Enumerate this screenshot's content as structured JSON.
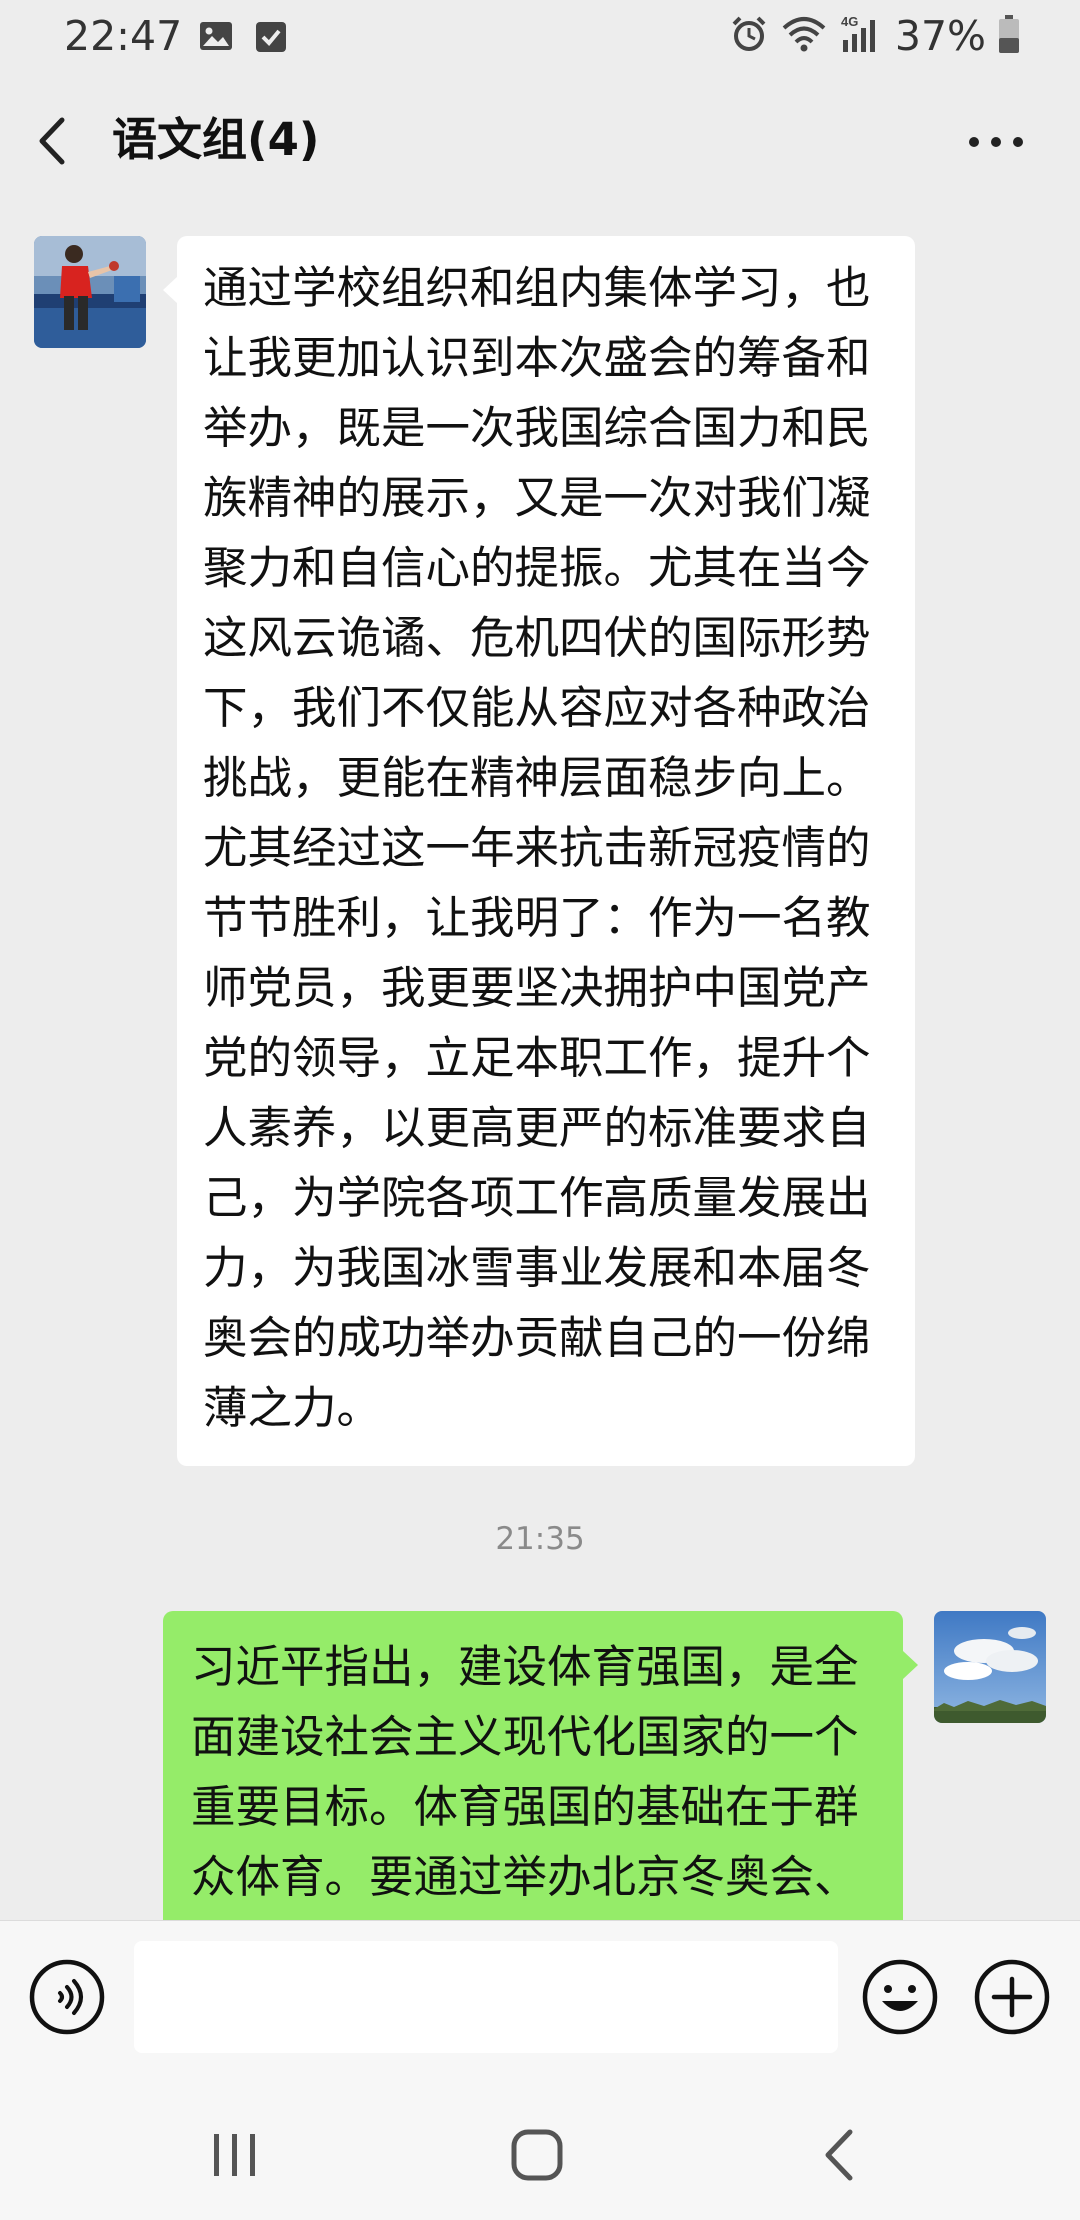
{
  "status_bar": {
    "time": "22:47",
    "battery": "37%",
    "icons": [
      "image-icon",
      "checkbox-icon",
      "alarm-icon",
      "wifi-icon",
      "4g-signal-icon",
      "battery-icon"
    ]
  },
  "header": {
    "back_icon": "chevron-left-icon",
    "title": "语文组(4)",
    "more_icon": "ellipsis-icon"
  },
  "messages": [
    {
      "direction": "incoming",
      "avatar": "table-tennis-photo",
      "text": "通过学校组织和组内集体学习，也\n让我更加认识到本次盛会的筹备和\n举办，既是一次我国综合国力和民\n族精神的展示，又是一次对我们凝\n聚力和自信心的提振。尤其在当今\n这风云诡谲、危机四伏的国际形势\n下，我们不仅能从容应对各种政治\n挑战，更能在精神层面稳步向上。\n尤其经过这一年来抗击新冠疫情的\n节节胜利，让我明了：作为一名教\n师党员，我更要坚决拥护中国党产\n党的领导，立足本职工作，提升个\n人素养，以更高更严的标准要求自\n己，为学院各项工作高质量发展出\n力，为我国冰雪事业发展和本届冬\n奥会的成功举办贡献自己的一份绵\n薄之力。"
    },
    {
      "direction": "outgoing",
      "avatar": "sky-clouds-photo",
      "text": "习近平指出，建设体育强国，是全\n面建设社会主义现代化国家的一个\n重要目标。体育强国的基础在于群\n众体育。要通过举办北京冬奥会、"
    }
  ],
  "timestamp": "21:35",
  "input_bar": {
    "voice_icon": "voice-icon",
    "input_value": "",
    "emoji_icon": "emoji-icon",
    "plus_icon": "plus-icon"
  },
  "nav_bar": {
    "icons": [
      "recent-apps-icon",
      "home-icon",
      "back-icon"
    ]
  },
  "colors": {
    "background": "#ededed",
    "incoming_bubble": "#ffffff",
    "outgoing_bubble": "#95ec69",
    "timestamp_text": "#8a8a8a"
  }
}
